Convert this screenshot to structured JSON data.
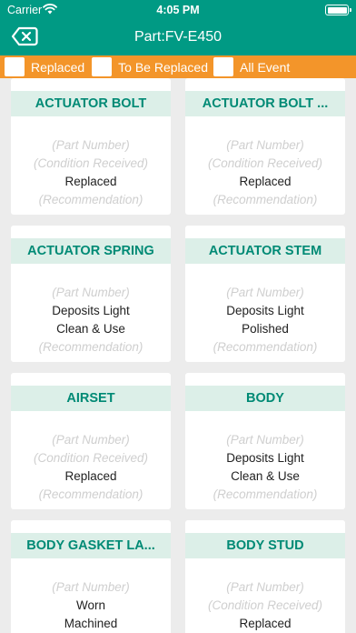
{
  "status_bar": {
    "carrier": "Carrier",
    "time": "4:05 PM"
  },
  "nav": {
    "title": "Part:FV-E450"
  },
  "filters": [
    {
      "label": "Replaced"
    },
    {
      "label": "To Be Replaced"
    },
    {
      "label": "All Event"
    }
  ],
  "colors": {
    "header": "#009a84",
    "filter_bar": "#f3952a",
    "title_bg": "#dcefe8",
    "title_text": "#008a75"
  },
  "cards": [
    {
      "title": "ACTUATOR BOLT",
      "lines": [
        {
          "text": "(Part Number)",
          "placeholder": true
        },
        {
          "text": "(Condition Received)",
          "placeholder": true
        },
        {
          "text": "Replaced",
          "placeholder": false
        },
        {
          "text": "(Recommendation)",
          "placeholder": true
        }
      ]
    },
    {
      "title": "ACTUATOR BOLT ...",
      "lines": [
        {
          "text": "(Part Number)",
          "placeholder": true
        },
        {
          "text": "(Condition Received)",
          "placeholder": true
        },
        {
          "text": "Replaced",
          "placeholder": false
        },
        {
          "text": "(Recommendation)",
          "placeholder": true
        }
      ]
    },
    {
      "title": "ACTUATOR SPRING",
      "lines": [
        {
          "text": "(Part Number)",
          "placeholder": true
        },
        {
          "text": "Deposits Light",
          "placeholder": false
        },
        {
          "text": "Clean & Use",
          "placeholder": false
        },
        {
          "text": "(Recommendation)",
          "placeholder": true
        }
      ]
    },
    {
      "title": "ACTUATOR STEM",
      "lines": [
        {
          "text": "(Part Number)",
          "placeholder": true
        },
        {
          "text": "Deposits Light",
          "placeholder": false
        },
        {
          "text": "Polished",
          "placeholder": false
        },
        {
          "text": "(Recommendation)",
          "placeholder": true
        }
      ]
    },
    {
      "title": "AIRSET",
      "lines": [
        {
          "text": "(Part Number)",
          "placeholder": true
        },
        {
          "text": "(Condition Received)",
          "placeholder": true
        },
        {
          "text": "Replaced",
          "placeholder": false
        },
        {
          "text": "(Recommendation)",
          "placeholder": true
        }
      ]
    },
    {
      "title": "BODY",
      "lines": [
        {
          "text": "(Part Number)",
          "placeholder": true
        },
        {
          "text": "Deposits Light",
          "placeholder": false
        },
        {
          "text": "Clean & Use",
          "placeholder": false
        },
        {
          "text": "(Recommendation)",
          "placeholder": true
        }
      ]
    },
    {
      "title": "BODY GASKET LA...",
      "lines": [
        {
          "text": "(Part Number)",
          "placeholder": true
        },
        {
          "text": "Worn",
          "placeholder": false
        },
        {
          "text": "Machined",
          "placeholder": false
        },
        {
          "text": "",
          "placeholder": true
        }
      ]
    },
    {
      "title": "BODY STUD",
      "lines": [
        {
          "text": "(Part Number)",
          "placeholder": true
        },
        {
          "text": "(Condition Received)",
          "placeholder": true
        },
        {
          "text": "Replaced",
          "placeholder": false
        },
        {
          "text": "",
          "placeholder": true
        }
      ]
    }
  ]
}
